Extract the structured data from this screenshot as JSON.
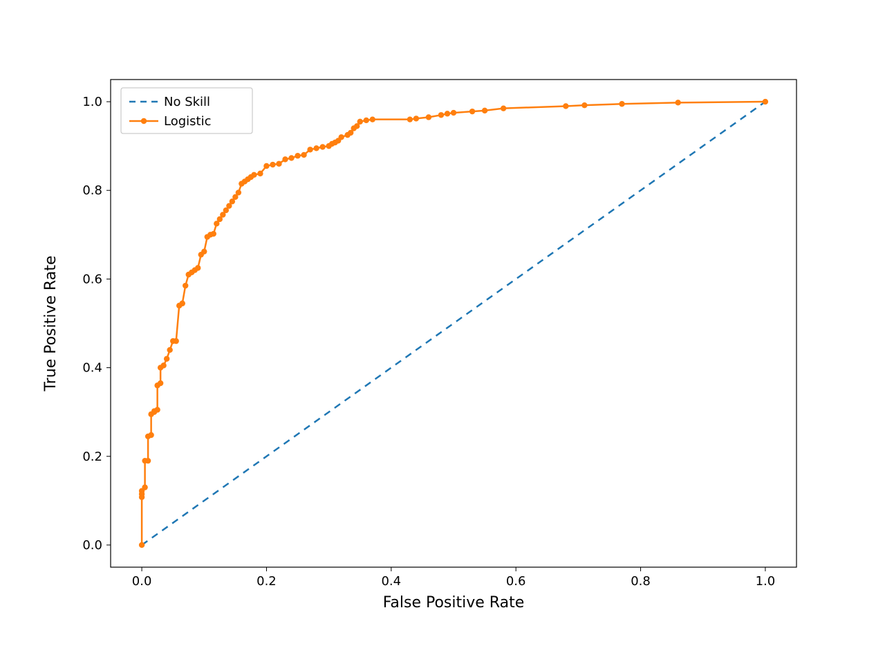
{
  "chart_data": {
    "type": "line",
    "title": "",
    "xlabel": "False Positive Rate",
    "ylabel": "True Positive Rate",
    "xlim": [
      -0.05,
      1.05
    ],
    "ylim": [
      -0.05,
      1.05
    ],
    "xticks": [
      0.0,
      0.2,
      0.4,
      0.6,
      0.8,
      1.0
    ],
    "yticks": [
      0.0,
      0.2,
      0.4,
      0.6,
      0.8,
      1.0
    ],
    "legend": {
      "position": "upper left",
      "entries": [
        "No Skill",
        "Logistic"
      ]
    },
    "series": [
      {
        "name": "No Skill",
        "style": "dashed",
        "color": "#1f77b4",
        "markers": false,
        "x": [
          0,
          1
        ],
        "y": [
          0,
          1
        ]
      },
      {
        "name": "Logistic",
        "style": "solid",
        "color": "#ff7f0e",
        "markers": true,
        "x": [
          0.0,
          0.0,
          0.0,
          0.0,
          0.005,
          0.005,
          0.01,
          0.01,
          0.015,
          0.015,
          0.02,
          0.02,
          0.025,
          0.025,
          0.03,
          0.03,
          0.035,
          0.04,
          0.045,
          0.05,
          0.055,
          0.06,
          0.065,
          0.065,
          0.07,
          0.075,
          0.08,
          0.085,
          0.09,
          0.095,
          0.1,
          0.105,
          0.11,
          0.115,
          0.12,
          0.125,
          0.13,
          0.135,
          0.14,
          0.145,
          0.15,
          0.155,
          0.16,
          0.165,
          0.17,
          0.175,
          0.18,
          0.19,
          0.2,
          0.21,
          0.22,
          0.23,
          0.24,
          0.25,
          0.26,
          0.27,
          0.28,
          0.29,
          0.3,
          0.305,
          0.31,
          0.315,
          0.32,
          0.33,
          0.335,
          0.34,
          0.345,
          0.35,
          0.36,
          0.37,
          0.43,
          0.44,
          0.46,
          0.48,
          0.49,
          0.5,
          0.53,
          0.55,
          0.58,
          0.68,
          0.71,
          0.77,
          0.86,
          1.0
        ],
        "y": [
          0.0,
          0.108,
          0.115,
          0.122,
          0.13,
          0.19,
          0.19,
          0.245,
          0.248,
          0.295,
          0.3,
          0.302,
          0.305,
          0.36,
          0.365,
          0.4,
          0.405,
          0.42,
          0.44,
          0.46,
          0.46,
          0.54,
          0.545,
          0.545,
          0.585,
          0.61,
          0.615,
          0.62,
          0.625,
          0.655,
          0.662,
          0.695,
          0.7,
          0.702,
          0.725,
          0.735,
          0.745,
          0.755,
          0.765,
          0.775,
          0.785,
          0.795,
          0.815,
          0.82,
          0.825,
          0.83,
          0.835,
          0.838,
          0.855,
          0.858,
          0.86,
          0.87,
          0.873,
          0.878,
          0.88,
          0.892,
          0.895,
          0.898,
          0.9,
          0.905,
          0.908,
          0.912,
          0.92,
          0.925,
          0.93,
          0.94,
          0.945,
          0.955,
          0.958,
          0.96,
          0.96,
          0.962,
          0.965,
          0.97,
          0.973,
          0.975,
          0.978,
          0.98,
          0.985,
          0.99,
          0.992,
          0.995,
          0.998,
          1.0
        ]
      }
    ]
  },
  "colors": {
    "no_skill": "#1f77b4",
    "logistic": "#ff7f0e",
    "axis": "#000000",
    "legend_border": "#bfbfbf",
    "legend_bg": "#ffffff"
  }
}
